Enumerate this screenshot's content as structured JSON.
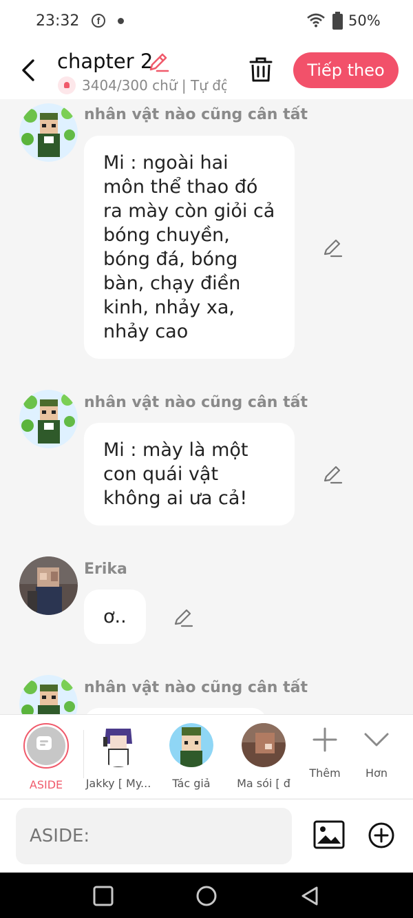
{
  "status": {
    "time": "23:32",
    "battery": "50%",
    "icons": [
      "facebook-icon",
      "dot-icon",
      "wifi-icon",
      "battery-icon"
    ]
  },
  "header": {
    "title": "chapter 2",
    "subtitle": "3404/300 chữ | Tự độ",
    "next_label": "Tiếp theo",
    "accent": "#f2516a"
  },
  "messages": [
    {
      "name": "nhân vật nào cũng cân tất",
      "text": "Mi : ngoài hai môn thể thao đó ra mày còn giỏi cả bóng chuyền, bóng đá, bóng bàn, chạy điền kinh, nhảy xa, nhảy cao"
    },
    {
      "name": "nhân vật nào cũng cân tất",
      "text": "Mi : mày là một con quái vật không ai ưa cả!"
    },
    {
      "name": "Erika",
      "text": "ơ.."
    },
    {
      "name": "nhân vật nào cũng cân tất",
      "text": ""
    }
  ],
  "characters": [
    {
      "label": "ASIDE"
    },
    {
      "label": "Jakky [ My..."
    },
    {
      "label": "Tác giả"
    },
    {
      "label": "Ma sói [ đ"
    },
    {
      "label": "Thêm"
    },
    {
      "label": "Hơn"
    }
  ],
  "input": {
    "placeholder": "ASIDE:"
  }
}
